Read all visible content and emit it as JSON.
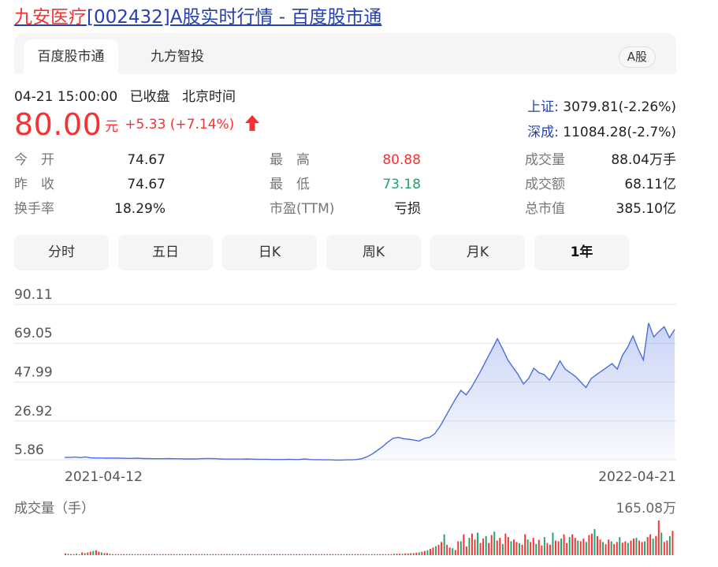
{
  "page": {
    "title_highlight": "九安医疗",
    "title_rest": "[002432]A股实时行情 - 百度股市通"
  },
  "tabs": {
    "main": "百度股市通",
    "second": "九方智投",
    "badge": "A股"
  },
  "status": {
    "datetime": "04-21 15:00:00",
    "state": "已收盘",
    "zone": "北京时间"
  },
  "quote": {
    "price": "80.00",
    "unit": "元",
    "change": "+5.33 (+7.14%)",
    "direction": "up"
  },
  "indices": [
    {
      "name": "上证:",
      "value": "3079.81(-2.26%)"
    },
    {
      "name": "深成:",
      "value": "11084.28(-2.7%)"
    }
  ],
  "stats": {
    "open": {
      "label": "今　开",
      "value": "74.67"
    },
    "prev_close": {
      "label": "昨　收",
      "value": "74.67"
    },
    "turnover_rate": {
      "label": "换手率",
      "value": "18.29%"
    },
    "high": {
      "label": "最　高",
      "value": "80.88"
    },
    "low": {
      "label": "最　低",
      "value": "73.18"
    },
    "pe": {
      "label": "市盈(TTM)",
      "value": "亏损"
    },
    "volume": {
      "label": "成交量",
      "value": "88.04万手"
    },
    "amount": {
      "label": "成交额",
      "value": "68.11亿"
    },
    "market_cap": {
      "label": "总市值",
      "value": "385.10亿"
    }
  },
  "range_buttons": [
    "分时",
    "五日",
    "日K",
    "周K",
    "月K",
    "1年"
  ],
  "range_active_index": 5,
  "colors": {
    "up": "#f73131",
    "down": "#1fa36a",
    "line": "#4a6ee0",
    "link": "#2440b3"
  },
  "chart_data": {
    "type": "area",
    "y_ticks": [
      "90.11",
      "69.05",
      "47.99",
      "26.92",
      "5.86"
    ],
    "ylim": [
      5.86,
      90.11
    ],
    "x_start_label": "2021-04-12",
    "x_end_label": "2022-04-21",
    "price_series": [
      7.2,
      7.1,
      7.3,
      7.0,
      7.4,
      6.9,
      6.8,
      6.8,
      6.7,
      6.8,
      6.7,
      6.7,
      6.6,
      6.6,
      6.7,
      6.5,
      6.5,
      6.4,
      6.4,
      6.4,
      6.5,
      6.4,
      6.4,
      6.3,
      6.3,
      6.3,
      6.4,
      6.5,
      6.5,
      6.4,
      6.3,
      6.2,
      6.2,
      6.2,
      6.2,
      6.3,
      6.2,
      6.1,
      6.1,
      6.1,
      6.0,
      6.0,
      6.0,
      6.1,
      6.0,
      6.0,
      6.3,
      6.0,
      5.9,
      5.9,
      5.8,
      5.8,
      5.7,
      5.7,
      5.8,
      5.8,
      6.0,
      6.4,
      7.5,
      9.0,
      11.0,
      13.0,
      15.5,
      17.5,
      18.0,
      17.3,
      17.0,
      16.5,
      16.0,
      17.5,
      18.0,
      20.0,
      24.0,
      29.0,
      34.0,
      39.0,
      43.5,
      41.0,
      45.0,
      50.0,
      55.0,
      60.5,
      66.0,
      71.5,
      66.0,
      60.0,
      56.0,
      52.0,
      47.0,
      50.0,
      55.5,
      53.0,
      52.0,
      49.0,
      54.0,
      59.5,
      55.0,
      53.0,
      51.0,
      48.0,
      45.0,
      50.0,
      52.0,
      54.0,
      56.0,
      58.0,
      55.0,
      62.5,
      67.0,
      73.0,
      66.0,
      60.0,
      80.0,
      72.5,
      75.5,
      78.0,
      72.0,
      76.5
    ],
    "volume_label": "成交量（手）",
    "volume_max_label": "165.08万",
    "volume_series": [
      5,
      4,
      3,
      3,
      4,
      2,
      8,
      6,
      8,
      10,
      12,
      14,
      10,
      8,
      6,
      6,
      4,
      3,
      3,
      3,
      3,
      3,
      3,
      3,
      3,
      3,
      3,
      3,
      3,
      3,
      3,
      3,
      3,
      3,
      3,
      3,
      3,
      3,
      3,
      3,
      3,
      3,
      3,
      3,
      3,
      3,
      3,
      3,
      3,
      3,
      3,
      3,
      3,
      3,
      3,
      3,
      3,
      3,
      3,
      3,
      3,
      3,
      3,
      3,
      3,
      3,
      3,
      3,
      3,
      3,
      3,
      3,
      3,
      3,
      3,
      3,
      3,
      3,
      3,
      3,
      3,
      3,
      3,
      3,
      3,
      3,
      3,
      3,
      3,
      3,
      3,
      3,
      3,
      3,
      3,
      3,
      3,
      3,
      3,
      3,
      3,
      3,
      3,
      3,
      3,
      3,
      3,
      3,
      3,
      3,
      3,
      3,
      3,
      3,
      3,
      3,
      3,
      3,
      4,
      4,
      4,
      4,
      5,
      5,
      6,
      6,
      7,
      8,
      10,
      12,
      14,
      18,
      22,
      26,
      30,
      38,
      60,
      30,
      22,
      20,
      15,
      40,
      40,
      60,
      25,
      50,
      62,
      45,
      65,
      35,
      48,
      55,
      35,
      58,
      68,
      42,
      50,
      32,
      62,
      52,
      40,
      45,
      38,
      34,
      30,
      60,
      45,
      38,
      50,
      32,
      44,
      28,
      52,
      35,
      30,
      65,
      42,
      40,
      48,
      60,
      35,
      52,
      60,
      50,
      42,
      40,
      48,
      38,
      58,
      62,
      75,
      55,
      45,
      38,
      32,
      45,
      40,
      32,
      38,
      52,
      36,
      40,
      35,
      42,
      48,
      50,
      42,
      38,
      40,
      52,
      60,
      48,
      55,
      100,
      65,
      38,
      42,
      55,
      70
    ],
    "volume_colors_pattern": "alternating"
  }
}
